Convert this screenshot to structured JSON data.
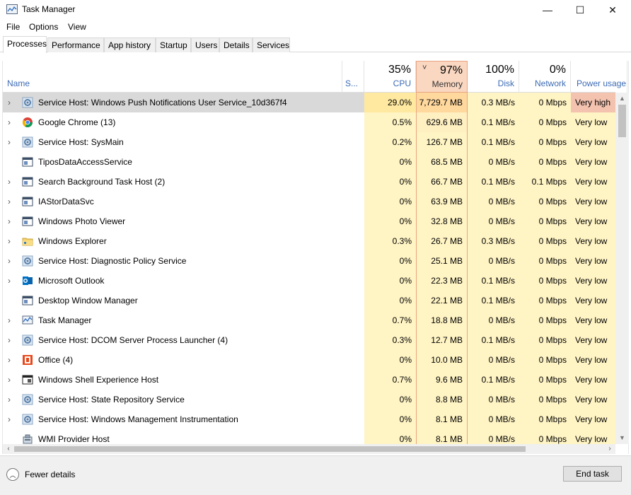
{
  "window": {
    "title": "Task Manager",
    "controls": {
      "minimize": "—",
      "maximize": "☐",
      "close": "✕"
    }
  },
  "menu": [
    "File",
    "Options",
    "View"
  ],
  "tabs": [
    "Processes",
    "Performance",
    "App history",
    "Startup",
    "Users",
    "Details",
    "Services"
  ],
  "active_tab": "Processes",
  "columns": {
    "name": "Name",
    "status": "S...",
    "cpu": {
      "pct": "35%",
      "label": "CPU"
    },
    "memory": {
      "pct": "97%",
      "label": "Memory",
      "sort_indicator": "˅"
    },
    "disk": {
      "pct": "100%",
      "label": "Disk"
    },
    "network": {
      "pct": "0%",
      "label": "Network"
    },
    "power": {
      "label": "Power usage"
    }
  },
  "heat_colors": {
    "cpu_low": "#fff4c4",
    "cpu_mid": "#ffe9a0",
    "mem_high": "#ffd89e",
    "mem_mid": "#fff0c2",
    "power_very_high": "#f3c3b0",
    "selected": "#d9d9d9"
  },
  "processes": [
    {
      "expand": "›",
      "icon": "gear-icon",
      "name": "Service Host: Windows Push Notifications User Service_10d367f4",
      "cpu": "29.0%",
      "memory": "7,729.7 MB",
      "disk": "0.3 MB/s",
      "network": "0 Mbps",
      "power": "Very high"
    },
    {
      "expand": "›",
      "icon": "chrome-icon",
      "name": "Google Chrome (13)",
      "cpu": "0.5%",
      "memory": "629.6 MB",
      "disk": "0.1 MB/s",
      "network": "0 Mbps",
      "power": "Very low"
    },
    {
      "expand": "›",
      "icon": "gear-icon",
      "name": "Service Host: SysMain",
      "cpu": "0.2%",
      "memory": "126.7 MB",
      "disk": "0.1 MB/s",
      "network": "0 Mbps",
      "power": "Very low"
    },
    {
      "expand": "",
      "icon": "window-icon",
      "name": "TiposDataAccessService",
      "cpu": "0%",
      "memory": "68.5 MB",
      "disk": "0 MB/s",
      "network": "0 Mbps",
      "power": "Very low"
    },
    {
      "expand": "›",
      "icon": "window-icon",
      "name": "Search Background Task Host (2)",
      "cpu": "0%",
      "memory": "66.7 MB",
      "disk": "0.1 MB/s",
      "network": "0.1 Mbps",
      "power": "Very low"
    },
    {
      "expand": "›",
      "icon": "window-icon",
      "name": "IAStorDataSvc",
      "cpu": "0%",
      "memory": "63.9 MB",
      "disk": "0 MB/s",
      "network": "0 Mbps",
      "power": "Very low"
    },
    {
      "expand": "›",
      "icon": "window-icon",
      "name": "Windows Photo Viewer",
      "cpu": "0%",
      "memory": "32.8 MB",
      "disk": "0 MB/s",
      "network": "0 Mbps",
      "power": "Very low"
    },
    {
      "expand": "›",
      "icon": "folder-icon",
      "name": "Windows Explorer",
      "cpu": "0.3%",
      "memory": "26.7 MB",
      "disk": "0.3 MB/s",
      "network": "0 Mbps",
      "power": "Very low"
    },
    {
      "expand": "›",
      "icon": "gear-icon",
      "name": "Service Host: Diagnostic Policy Service",
      "cpu": "0%",
      "memory": "25.1 MB",
      "disk": "0 MB/s",
      "network": "0 Mbps",
      "power": "Very low"
    },
    {
      "expand": "›",
      "icon": "outlook-icon",
      "name": "Microsoft Outlook",
      "cpu": "0%",
      "memory": "22.3 MB",
      "disk": "0.1 MB/s",
      "network": "0 Mbps",
      "power": "Very low"
    },
    {
      "expand": "",
      "icon": "window-icon",
      "name": "Desktop Window Manager",
      "cpu": "0%",
      "memory": "22.1 MB",
      "disk": "0.1 MB/s",
      "network": "0 Mbps",
      "power": "Very low"
    },
    {
      "expand": "›",
      "icon": "taskmanager-icon",
      "name": "Task Manager",
      "cpu": "0.7%",
      "memory": "18.8 MB",
      "disk": "0 MB/s",
      "network": "0 Mbps",
      "power": "Very low"
    },
    {
      "expand": "›",
      "icon": "gear-icon",
      "name": "Service Host: DCOM Server Process Launcher (4)",
      "cpu": "0.3%",
      "memory": "12.7 MB",
      "disk": "0.1 MB/s",
      "network": "0 Mbps",
      "power": "Very low"
    },
    {
      "expand": "›",
      "icon": "office-icon",
      "name": "Office (4)",
      "cpu": "0%",
      "memory": "10.0 MB",
      "disk": "0 MB/s",
      "network": "0 Mbps",
      "power": "Very low"
    },
    {
      "expand": "›",
      "icon": "shell-icon",
      "name": "Windows Shell Experience Host",
      "cpu": "0.7%",
      "memory": "9.6 MB",
      "disk": "0.1 MB/s",
      "network": "0 Mbps",
      "power": "Very low"
    },
    {
      "expand": "›",
      "icon": "gear-icon",
      "name": "Service Host: State Repository Service",
      "cpu": "0%",
      "memory": "8.8 MB",
      "disk": "0 MB/s",
      "network": "0 Mbps",
      "power": "Very low"
    },
    {
      "expand": "›",
      "icon": "gear-icon",
      "name": "Service Host: Windows Management Instrumentation",
      "cpu": "0%",
      "memory": "8.1 MB",
      "disk": "0 MB/s",
      "network": "0 Mbps",
      "power": "Very low"
    },
    {
      "expand": "",
      "icon": "wmi-icon",
      "name": "WMI Provider Host",
      "cpu": "0%",
      "memory": "8.1 MB",
      "disk": "0 MB/s",
      "network": "0 Mbps",
      "power": "Very low"
    }
  ],
  "footer": {
    "fewer_details": "Fewer details",
    "end_task": "End task"
  }
}
